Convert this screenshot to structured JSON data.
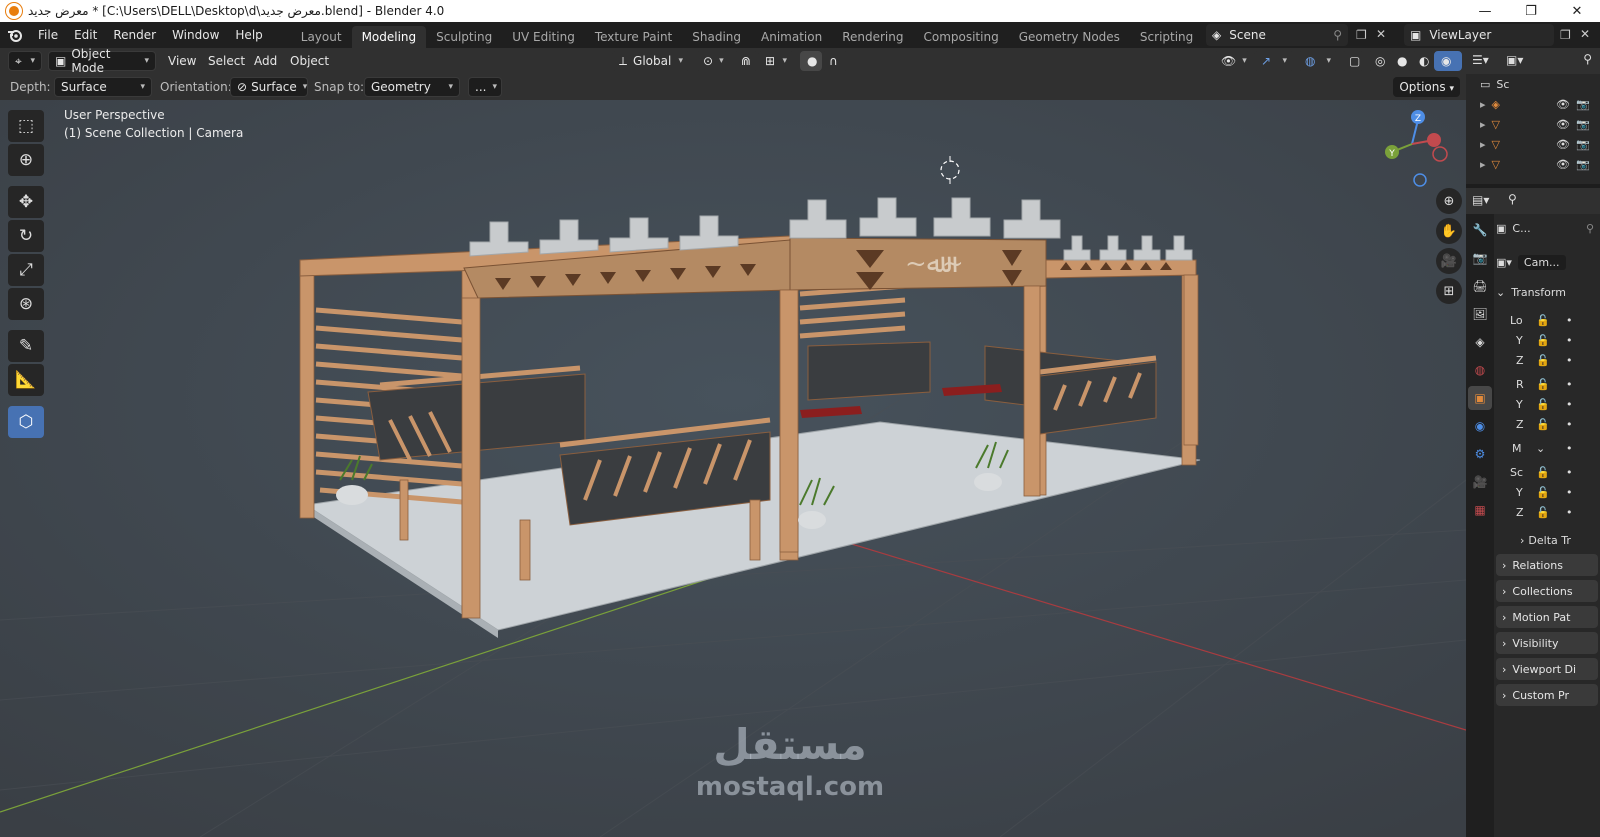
{
  "window": {
    "title": "معرض جديد * [C:\\Users\\DELL\\Desktop\\d\\معرض جديد.blend] - Blender 4.0",
    "minimize": "—",
    "maximize": "❐",
    "close": "✕"
  },
  "menu": [
    "File",
    "Edit",
    "Render",
    "Window",
    "Help"
  ],
  "workspaces": [
    "Layout",
    "Modeling",
    "Sculpting",
    "UV Editing",
    "Texture Paint",
    "Shading",
    "Animation",
    "Rendering",
    "Compositing",
    "Geometry Nodes",
    "Scripting"
  ],
  "active_workspace": "Modeling",
  "scene": {
    "name": "Scene",
    "view_layer": "ViewLayer"
  },
  "header": {
    "mode": "Object Mode",
    "menus": [
      "View",
      "Select",
      "Add",
      "Object"
    ],
    "orientation": "Global"
  },
  "tool_settings": {
    "depth_label": "Depth:",
    "depth_value": "Surface",
    "orientation_label": "Orientation:",
    "orientation_value": "Surface",
    "snap_label": "Snap to:",
    "snap_value": "Geometry",
    "more": "...",
    "options": "Options"
  },
  "viewport": {
    "perspective": "User Perspective",
    "collection": "(1) Scene Collection | Camera",
    "axes": {
      "x": "X",
      "y": "Y",
      "z": "Z"
    }
  },
  "outliner": {
    "root": "Sc"
  },
  "properties": {
    "object_name": "C...",
    "data_name": "Cam...",
    "transform_label": "Transform",
    "rows": [
      "Lo",
      "Y",
      "Z",
      "R",
      "Y",
      "Z",
      "M",
      "Sc",
      "Y",
      "Z"
    ],
    "panels": [
      "Delta Tr",
      "Relations",
      "Collections",
      "Motion Pat",
      "Visibility",
      "Viewport Di",
      "Custom Pr"
    ]
  },
  "watermark": {
    "arabic": "مستقل",
    "latin": "mostaql.com"
  },
  "colors": {
    "accent": "#4772b3",
    "wood": "#c9956a",
    "floor": "#cfd3d6",
    "viewport_bg": "#3d3d3d"
  }
}
